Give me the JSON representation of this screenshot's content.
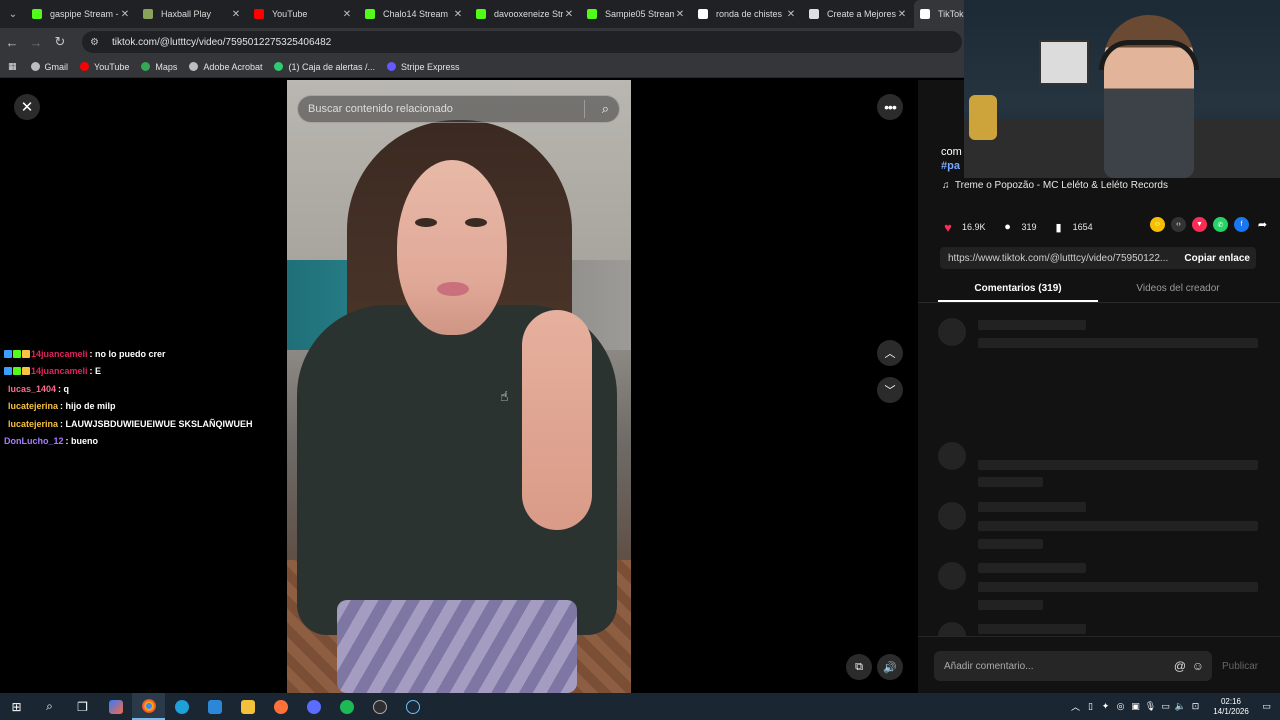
{
  "browser": {
    "tabs": [
      {
        "title": "gaspipe Stream -",
        "icon": "kick-icon",
        "color": "#53fc18"
      },
      {
        "title": "Haxball Play",
        "icon": "haxball-icon",
        "color": "#8aa35a"
      },
      {
        "title": "YouTube",
        "icon": "youtube-icon",
        "color": "#ff0000"
      },
      {
        "title": "Chalo14 Stream",
        "icon": "kick-icon",
        "color": "#53fc18"
      },
      {
        "title": "davooxeneize Str",
        "icon": "kick-icon",
        "color": "#53fc18"
      },
      {
        "title": "Sampie05 Stream",
        "icon": "kick-icon",
        "color": "#53fc18"
      },
      {
        "title": "ronda de chistes",
        "icon": "google-icon",
        "color": "#ffffff"
      },
      {
        "title": "Create a Mejores",
        "icon": "page-icon",
        "color": "#e0e0e0"
      },
      {
        "title": "TikTok -",
        "icon": "tiktok-icon",
        "color": "#ffffff"
      }
    ],
    "url": "tiktok.com/@lutttcy/video/7595012275325406482",
    "bookmarks": [
      {
        "label": "Gmail",
        "color": "#bdbdbd"
      },
      {
        "label": "YouTube",
        "color": "#ff0000"
      },
      {
        "label": "Maps",
        "color": "#34a853"
      },
      {
        "label": "Adobe Acrobat",
        "color": "#bdbdbd"
      },
      {
        "label": "(1) Caja de alertas /...",
        "color": "#2ecc71"
      },
      {
        "label": "Stripe Express",
        "color": "#635bff"
      }
    ]
  },
  "video": {
    "search_placeholder": "Buscar contenido relacionado"
  },
  "panel": {
    "desc_line1": "com",
    "desc_tag": "#pa",
    "music": "Treme o Popozão - MC Leléto & Leléto Records",
    "likes": "16.9K",
    "comments": "319",
    "saves": "1654",
    "link": "https://www.tiktok.com/@lutttcy/video/75950122...",
    "copy_label": "Copiar enlace",
    "tab_comments": "Comentarios (319)",
    "tab_creator": "Videos del creador",
    "comment_placeholder": "Añadir comentario...",
    "publish": "Publicar"
  },
  "chat": [
    {
      "user": "14juancameli",
      "text": ": no lo puedo crer",
      "color": "#e0245e",
      "badges": true
    },
    {
      "user": "14juancameli",
      "text": ": E",
      "color": "#e0245e",
      "badges": true
    },
    {
      "user": "lucas_1404",
      "text": ": q",
      "color": "#ff6b8b",
      "badges": false
    },
    {
      "user": "lucatejerina",
      "text": ": hijo de milp",
      "color": "#f5c242",
      "badges": false
    },
    {
      "user": "lucatejerina",
      "text": ": LAUWJSBDUWIEUEIWUE SKSLAÑQIWUEH",
      "color": "#f5c242",
      "badges": false
    },
    {
      "user": "DonLucho_12",
      "text": ": bueno",
      "color": "#a77bff",
      "badges": false
    }
  ],
  "taskbar": {
    "time": "02:16",
    "date": "14/1/2026"
  }
}
